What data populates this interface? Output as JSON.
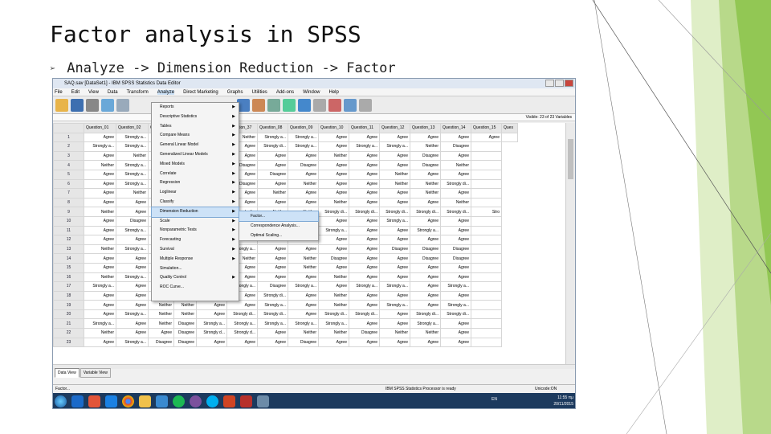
{
  "slide": {
    "title": "Factor analysis in SPSS",
    "bullet": "Analyze -> Dimension Reduction -> Factor"
  },
  "window": {
    "title": "SAQ.sav [DataSet1] - IBM SPSS Statistics Data Editor",
    "menus": [
      "File",
      "Edit",
      "View",
      "Data",
      "Transform",
      "Analyze",
      "Direct Marketing",
      "Graphs",
      "Utilities",
      "Add-ons",
      "Window",
      "Help"
    ],
    "active_menu": "Analyze",
    "visible_vars": "Visible: 23 of 23 Variables"
  },
  "grid": {
    "headers": [
      "Question_01",
      "Question_02",
      "Q",
      "",
      "Question_36",
      "Question_37",
      "Question_08",
      "Question_09",
      "Question_10",
      "Question_11",
      "Question_12",
      "Question_13",
      "Question_14",
      "Question_15",
      "Ques"
    ],
    "rows": [
      [
        "1",
        "Agree",
        "Strongly a...",
        "",
        "",
        "Agree",
        "Neither",
        "Strongly a...",
        "Strongly a...",
        "Agree",
        "Agree",
        "Agree",
        "Agree",
        "Agree",
        "Agree",
        ""
      ],
      [
        "2",
        "Strongly a...",
        "Strongly a...",
        "",
        "",
        "Agree",
        "Agree",
        "Strongly di...",
        "Strongly a...",
        "Agree",
        "Strongly a...",
        "Strongly a...",
        "Neither",
        "Disagree",
        ""
      ],
      [
        "3",
        "Agree",
        "Neither",
        "",
        "",
        "Strongly a...",
        "Agree",
        "Agree",
        "Agree",
        "Neither",
        "Agree",
        "Agree",
        "Disagree",
        "Agree",
        ""
      ],
      [
        "4",
        "Neither",
        "Strongly a...",
        "",
        "",
        "Neither",
        "Disagree",
        "Agree",
        "Disagree",
        "Agree",
        "Agree",
        "Agree",
        "Disagree",
        "Neither",
        ""
      ],
      [
        "5",
        "Agree",
        "Strongly a...",
        "",
        "",
        "Neither",
        "Agree",
        "Disagree",
        "Agree",
        "Agree",
        "Agree",
        "Neither",
        "Agree",
        "Agree",
        ""
      ],
      [
        "6",
        "Agree",
        "Strongly a...",
        "",
        "",
        "Disagree",
        "Disagree",
        "Agree",
        "Neither",
        "Agree",
        "Agree",
        "Neither",
        "Neither",
        "Strongly di...",
        ""
      ],
      [
        "7",
        "Agree",
        "Neither",
        "",
        "",
        "Neither",
        "Agree",
        "Neither",
        "Agree",
        "Agree",
        "Agree",
        "Agree",
        "Neither",
        "Agree",
        ""
      ],
      [
        "8",
        "Agree",
        "Agree",
        "",
        "",
        "Agree",
        "Agree",
        "Agree",
        "Agree",
        "Neither",
        "Agree",
        "Agree",
        "Agree",
        "Neither",
        ""
      ],
      [
        "9",
        "Neither",
        "Agree",
        "",
        "",
        "",
        "Strongly di...",
        "Neither",
        "Neither",
        "Strongly di...",
        "Strongly di...",
        "Strongly di...",
        "Strongly di...",
        "Strongly di...",
        "Stro"
      ],
      [
        "10",
        "Agree",
        "Disagree",
        "",
        "",
        "",
        "Agree",
        "Neither",
        "Agree",
        "Agree",
        "Agree",
        "Strongly a...",
        "Agree",
        "Agree",
        ""
      ],
      [
        "11",
        "Agree",
        "Strongly a...",
        "",
        "",
        "",
        "Agree",
        "Neither",
        "Agree",
        "Strongly a...",
        "Agree",
        "Agree",
        "Strongly a...",
        "Agree",
        ""
      ],
      [
        "12",
        "Agree",
        "Agree",
        "",
        "",
        "Neither",
        "Neither",
        "Agree",
        "Agree",
        "Agree",
        "Agree",
        "Agree",
        "Agree",
        "Agree",
        ""
      ],
      [
        "13",
        "Neither",
        "Strongly a...",
        "",
        "",
        "Neither",
        "Strongly a...",
        "Agree",
        "Agree",
        "Agree",
        "Agree",
        "Disagree",
        "Disagree",
        "Disagree",
        ""
      ],
      [
        "14",
        "Agree",
        "Agree",
        "",
        "",
        "Agree",
        "Neither",
        "Agree",
        "Neither",
        "Disagree",
        "Agree",
        "Agree",
        "Disagree",
        "Disagree",
        ""
      ],
      [
        "15",
        "Agree",
        "Agree",
        "",
        "",
        "Agree",
        "Agree",
        "Agree",
        "Neither",
        "Agree",
        "Agree",
        "Agree",
        "Agree",
        "Agree",
        ""
      ],
      [
        "16",
        "Neither",
        "Strongly a...",
        "",
        "",
        "Agree",
        "Agree",
        "Agree",
        "Agree",
        "Neither",
        "Agree",
        "Agree",
        "Agree",
        "Agree",
        ""
      ],
      [
        "17",
        "Strongly a...",
        "Agree",
        "",
        "",
        "Strongly a...",
        "Strongly a...",
        "Disagree",
        "Strongly a...",
        "Agree",
        "Strongly a...",
        "Strongly a...",
        "Agree",
        "Strongly a...",
        ""
      ],
      [
        "18",
        "Agree",
        "Agree",
        "Neither",
        "Neither",
        "Agree",
        "Agree",
        "Strongly di...",
        "Agree",
        "Neither",
        "Agree",
        "Agree",
        "Agree",
        "Agree",
        ""
      ],
      [
        "19",
        "Agree",
        "Agree",
        "Neither",
        "Neither",
        "Agree",
        "Agree",
        "Strongly a...",
        "Agree",
        "Neither",
        "Agree",
        "Strongly a...",
        "Agree",
        "Strongly a...",
        ""
      ],
      [
        "20",
        "Agree",
        "Strongly a...",
        "Neither",
        "Neither",
        "Agree",
        "Strongly di...",
        "Strongly di...",
        "Agree",
        "Strongly di...",
        "Strongly di...",
        "Agree",
        "Strongly di...",
        "Strongly di...",
        ""
      ],
      [
        "21",
        "Strongly a...",
        "Agree",
        "Neither",
        "Disagree",
        "Strongly a...",
        "Strongly a...",
        "Strongly a...",
        "Strongly a...",
        "Strongly a...",
        "Agree",
        "Agree",
        "Strongly a...",
        "Agree",
        ""
      ],
      [
        "22",
        "Neither",
        "Agree",
        "Agree",
        "Disagree",
        "Strongly d...",
        "Strongly d...",
        "Agree",
        "Neither",
        "Neither",
        "Disagree",
        "Neither",
        "Neither",
        "Agree",
        ""
      ],
      [
        "23",
        "Agree",
        "Strongly a...",
        "Disagree",
        "Disagree",
        "Agree",
        "Agree",
        "Agree",
        "Disagree",
        "Agree",
        "Agree",
        "Agree",
        "Agree",
        "Agree",
        ""
      ]
    ]
  },
  "analyze_menu": {
    "items": [
      "Reports",
      "Descriptive Statistics",
      "Tables",
      "Compare Means",
      "General Linear Model",
      "Generalized Linear Models",
      "Mixed Models",
      "Correlate",
      "Regression",
      "Loglinear",
      "Classify",
      "Dimension Reduction",
      "Scale",
      "Nonparametric Tests",
      "Forecasting",
      "Survival",
      "Multiple Response",
      "Simulation...",
      "Quality Control",
      "ROC Curve..."
    ],
    "highlighted": "Dimension Reduction"
  },
  "submenu": {
    "items": [
      "Factor...",
      "Correspondence Analysis...",
      "Optimal Scaling..."
    ],
    "highlighted": "Factor..."
  },
  "view_tabs": [
    "Data View",
    "Variable View"
  ],
  "status": {
    "left": "Factor...",
    "mid": "IBM SPSS Statistics Processor is ready",
    "right": "Unicode:ON"
  },
  "taskbar": {
    "lang": "EN",
    "time": "11:55 πμ",
    "date": "20/11/2015"
  },
  "colors": {
    "accent": "#8bc34a",
    "taskbar": "#1c3a5e",
    "highlight": "#cde2f7"
  }
}
